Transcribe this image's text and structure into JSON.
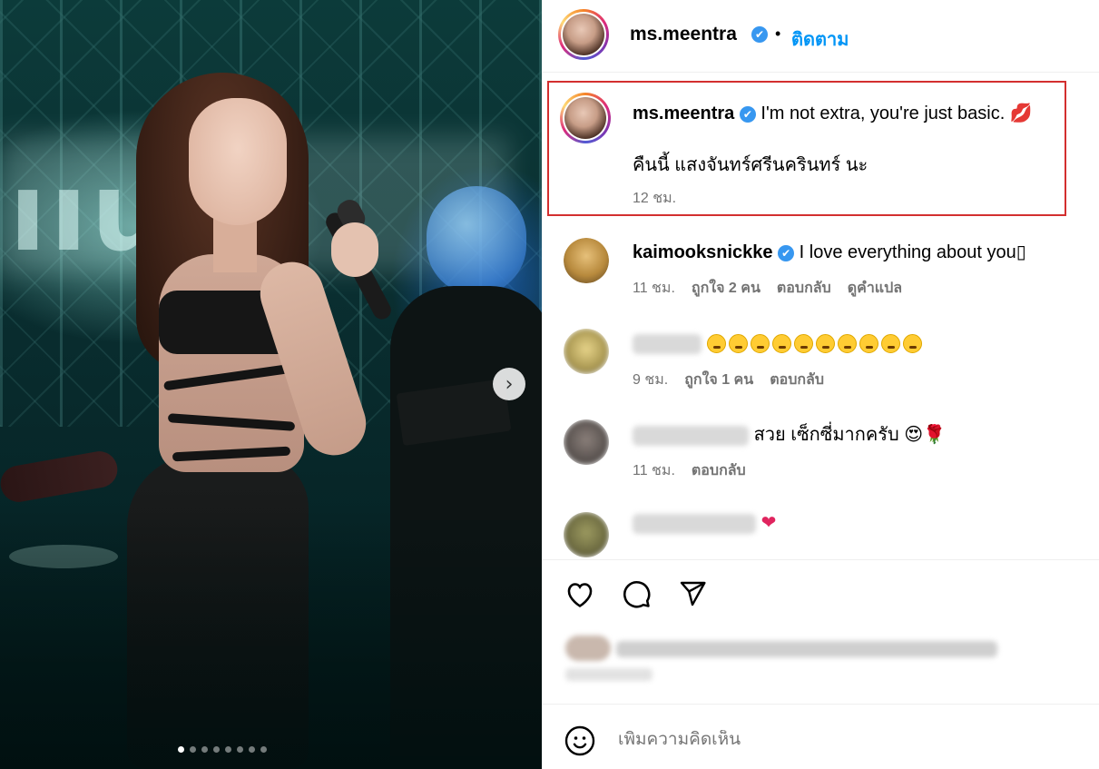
{
  "post": {
    "author": "ms.meentra",
    "follow_label": "ติดตาม",
    "separator": "•",
    "verified_glyph": "✔",
    "next_icon": "chevron-right-icon",
    "carousel_dot_count": 8,
    "carousel_active_index": 0
  },
  "caption": {
    "username": "ms.meentra",
    "line1": "I'm not extra, you're just basic. 💋",
    "line2": "คืนนี้ แสงจันทร์ศรีนครินทร์ นะ",
    "time": "12 ชม."
  },
  "comments": [
    {
      "username": "kaimooksnickke",
      "verified": true,
      "text": "I love everything about you▯",
      "time": "11 ชม.",
      "likes": "ถูกใจ 2 คน",
      "reply": "ตอบกลับ",
      "translate": "ดูคำแปล"
    },
    {
      "username_blurred": true,
      "text_emojis": 10,
      "time": "9 ชม.",
      "likes": "ถูกใจ 1 คน",
      "reply": "ตอบกลับ"
    },
    {
      "username_blurred": true,
      "text": "สวย เซ็กซี่มากครับ 😍🌹",
      "time": "11 ชม.",
      "reply": "ตอบกลับ"
    },
    {
      "username_blurred": true,
      "text": "❤"
    }
  ],
  "actions": {
    "like_icon": "heart-icon",
    "comment_icon": "comment-icon",
    "share_icon": "send-icon"
  },
  "composer": {
    "emoji_icon": "smiley-icon",
    "placeholder": "เพิ่มความคิดเห็น"
  },
  "colors": {
    "link_blue": "#0095f6",
    "verified_blue": "#3797f0",
    "highlight_red": "#d32f2f",
    "meta_gray": "#737373"
  }
}
